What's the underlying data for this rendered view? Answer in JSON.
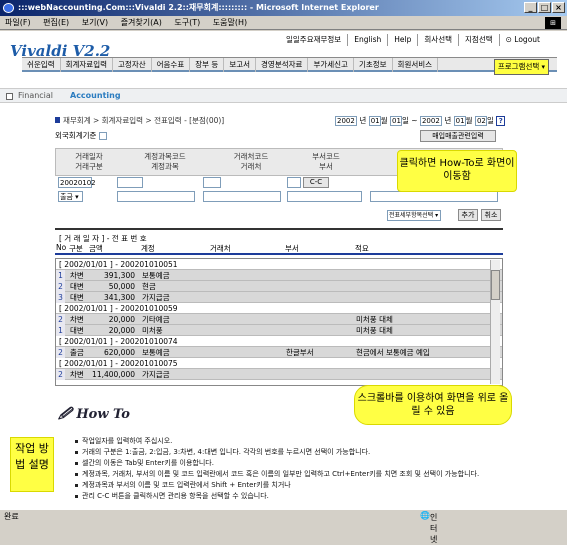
{
  "window": {
    "title": ":::webNaccounting.Com:::Vivaldi 2.2::재무회계::::::::: - Microsoft Internet Explorer"
  },
  "menu": [
    "파일(F)",
    "편집(E)",
    "보기(V)",
    "즐겨찾기(A)",
    "도구(T)",
    "도움말(H)"
  ],
  "topnav": [
    "일일주요재무정보",
    "English",
    "Help",
    "회사선택",
    "지점선택",
    "Logout"
  ],
  "logo": "Vivaldi  V2.2",
  "tabs": [
    "쉬운입력",
    "회계자료입력",
    "고정자산",
    "어음수표",
    "장부 등",
    "보고서",
    "경영분석자료",
    "부가세신고",
    "기초정보",
    "회원서비스"
  ],
  "program_select": "프로그램선택",
  "finbar": {
    "a": "Financial",
    "b": "Accounting"
  },
  "breadcrumb": "재무회계 > 회계자료입력 > 전표입력 - [분점(00)]",
  "dates": {
    "from_y": "2002",
    "from_m": "01",
    "from_d": "01",
    "to_y": "2002",
    "to_m": "01",
    "to_d": "02",
    "y": "년",
    "m": "월",
    "d": "일",
    "tilde": "~"
  },
  "foreign_label": "외국회계기준",
  "sales_button": "매입매출관련입력",
  "grid_headers": {
    "c1a": "거래일자",
    "c1b": "거래구분",
    "c2a": "계정과목코드",
    "c2b": "계정과목",
    "c3a": "거래처코드",
    "c3b": "거래처",
    "c4a": "부서코드",
    "c4b": "부서"
  },
  "form": {
    "date": "20020102",
    "type": "출금",
    "cc_button": "C-C"
  },
  "actions": {
    "voucher_select": "전표세부항목선택",
    "add": "추가",
    "cancel": "취소"
  },
  "table": {
    "title": "[ 거 래 일 자 ] - 전  표  번  호",
    "headers": [
      "No",
      "구분",
      "금액",
      "계정",
      "거래처",
      "부서",
      "적요"
    ],
    "groups": [
      {
        "label": "[ 2002/01/01 ] - 200201010051",
        "rows": [
          {
            "no": "1",
            "type": "차변",
            "amount": "391,300",
            "account": "보통예금",
            "partner": "",
            "dept": "",
            "memo": ""
          },
          {
            "no": "2",
            "type": "대변",
            "amount": "50,000",
            "account": "현금",
            "partner": "",
            "dept": "",
            "memo": ""
          },
          {
            "no": "3",
            "type": "대변",
            "amount": "341,300",
            "account": "가지급금",
            "partner": "",
            "dept": "",
            "memo": ""
          }
        ]
      },
      {
        "label": "[ 2002/01/01 ] - 200201010059",
        "rows": [
          {
            "no": "2",
            "type": "차변",
            "amount": "20,000",
            "account": "기타예금",
            "partner": "",
            "dept": "",
            "memo": "미처풍 대체"
          },
          {
            "no": "1",
            "type": "대변",
            "amount": "20,000",
            "account": "미처풍",
            "partner": "",
            "dept": "",
            "memo": "미처풍 대체"
          }
        ]
      },
      {
        "label": "[ 2002/01/01 ] - 200201010074",
        "rows": [
          {
            "no": "2",
            "type": "출금",
            "amount": "620,000",
            "account": "보통예금",
            "partner": "",
            "dept": "한글부서",
            "memo": "현금에서 보통예금 예입"
          }
        ]
      },
      {
        "label": "[ 2002/01/01 ] - 200201010075",
        "rows": [
          {
            "no": "2",
            "type": "차변",
            "amount": "11,400,000",
            "account": "가지급금",
            "partner": "",
            "dept": "",
            "memo": ""
          }
        ]
      }
    ]
  },
  "howto": {
    "title": "How To"
  },
  "instructions": [
    "작업일자를 입력하여 주십시오.",
    "거래의 구분은 1:출금, 2:입금, 3:차변, 4:대변 입니다. 각각의 번호를 누르시면 선택이 가능합니다.",
    "셀간의 이동은 Tab및 Enter키를 이용합니다.",
    "계정과목, 거래처, 부서의 이름 및 코드 입력란에서 코드 혹은 이름의 일부만 입력하고 Ctrl+Enter키를 치면 조회 및 선택이 가능합니다.",
    "계정과목과 부서의 이름 및 코드 입력란에서 Shift + Enter키를 치거나",
    "관리  C-C  버튼을 클릭하시면 관리용 항목을 선택할 수 있습니다."
  ],
  "callouts": {
    "c1": "클릭하면 How-To로 화면이 이동함",
    "c2": "스크롤바를 이용하여 화면을 위로 올릴 수 있음",
    "c3": "작업 방법 설명"
  },
  "status": {
    "left": "완료",
    "right": "인터넷"
  }
}
